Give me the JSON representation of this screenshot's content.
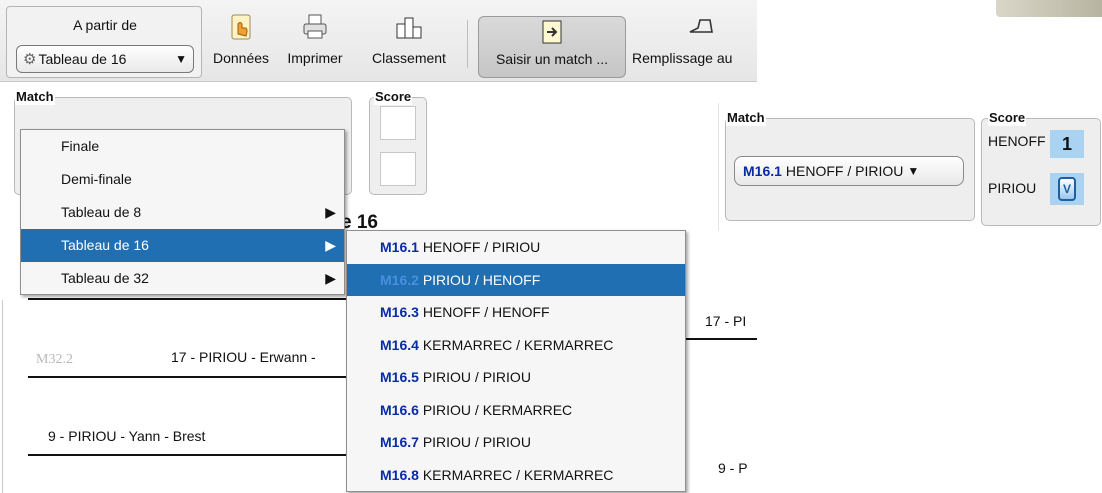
{
  "toolbar": {
    "from_label": "A partir de",
    "from_value": "Tableau de 16",
    "buttons": [
      {
        "label": "Données",
        "icon": "hand-pointer-icon"
      },
      {
        "label": "Imprimer",
        "icon": "printer-icon"
      },
      {
        "label": "Classement",
        "icon": "podium-icon"
      },
      {
        "label": "Saisir un match ...",
        "icon": "enter-match-icon"
      },
      {
        "label": "Remplissage au",
        "icon": "shoe-icon"
      }
    ]
  },
  "match_panel": {
    "title": "Match"
  },
  "score_panel": {
    "title": "Score"
  },
  "round_menu": {
    "items": [
      {
        "label": "Finale",
        "has_submenu": false
      },
      {
        "label": "Demi-finale",
        "has_submenu": false
      },
      {
        "label": "Tableau de 8",
        "has_submenu": true
      },
      {
        "label": "Tableau de 16",
        "has_submenu": true
      },
      {
        "label": "Tableau de 32",
        "has_submenu": true
      }
    ],
    "selected": "Tableau de 16"
  },
  "match_submenu": {
    "items": [
      {
        "code": "M16.1",
        "players": "HENOFF / PIRIOU"
      },
      {
        "code": "M16.2",
        "players": "PIRIOU / HENOFF"
      },
      {
        "code": "M16.3",
        "players": "HENOFF / HENOFF"
      },
      {
        "code": "M16.4",
        "players": "KERMARREC / KERMARREC"
      },
      {
        "code": "M16.5",
        "players": "PIRIOU / PIRIOU"
      },
      {
        "code": "M16.6",
        "players": "PIRIOU / KERMARREC"
      },
      {
        "code": "M16.7",
        "players": "PIRIOU / PIRIOU"
      },
      {
        "code": "M16.8",
        "players": "KERMARREC / KERMARREC"
      }
    ],
    "selected": "M16.2"
  },
  "bracket": {
    "title_fragment": "e 16",
    "match_code": "M32.2",
    "entries": [
      "17 - PIRIOU - Erwann -",
      "9 - PIRIOU - Yann - Brest",
      "17 - PI",
      "9 - P"
    ]
  },
  "inset": {
    "match_title": "Match",
    "score_title": "Score",
    "selected_code": "M16.1",
    "selected_players": "HENOFF / PIRIOU",
    "player1": "HENOFF",
    "player1_score": "1",
    "player2": "PIRIOU",
    "spinner_glyph": "V"
  },
  "colors": {
    "selection": "#1f6fb2",
    "match_code": "#0a2aa8",
    "score_cell": "#a9d3f0"
  }
}
